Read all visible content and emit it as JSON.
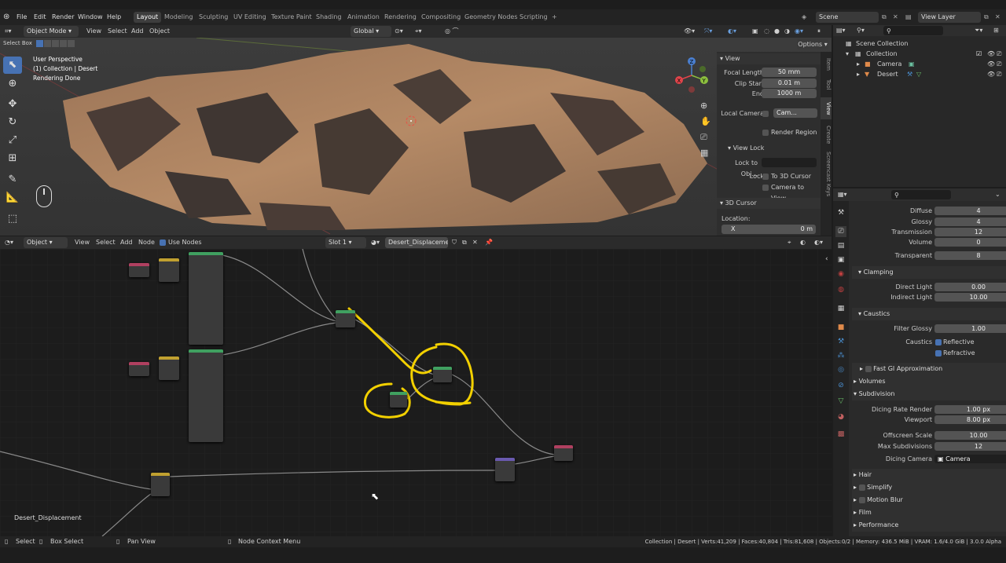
{
  "menu": {
    "items": [
      "File",
      "Edit",
      "Render",
      "Window",
      "Help"
    ]
  },
  "workspaces": [
    "Layout",
    "Modeling",
    "Sculpting",
    "UV Editing",
    "Texture Paint",
    "Shading",
    "Animation",
    "Rendering",
    "Compositing",
    "Geometry Nodes",
    "Scripting"
  ],
  "workspace_add": "+",
  "scene": {
    "label": "Scene",
    "view_layer": "View Layer"
  },
  "viewport": {
    "mode": "Object Mode",
    "menus": [
      "View",
      "Select",
      "Add",
      "Object"
    ],
    "orientation": "Global",
    "select_box": "Select Box",
    "options": "Options",
    "overlay_text": [
      "User Perspective",
      "(1) Collection | Desert",
      "Rendering Done"
    ]
  },
  "npanel": {
    "view_title": "View",
    "focal_length_label": "Focal Length",
    "focal_length": "50 mm",
    "clip_start_label": "Clip Start",
    "clip_start": "0.01 m",
    "end_label": "End",
    "end": "1000 m",
    "local_camera_label": "Local Camera",
    "local_camera_value": "Cam...",
    "render_region": "Render Region",
    "view_lock_title": "View Lock",
    "lock_to_obj_label": "Lock to Obj...",
    "lock_label": "Lock",
    "to_3d_cursor": "To 3D Cursor",
    "camera_to_view": "Camera to View",
    "cursor_title": "3D Cursor",
    "location_label": "Location:",
    "x_label": "X",
    "x_value": "0 m",
    "tabs": [
      "Item",
      "Tool",
      "View",
      "Create",
      "Screencast Keys"
    ]
  },
  "outliner": {
    "scene_collection": "Scene Collection",
    "collection": "Collection",
    "camera": "Camera",
    "desert": "Desert"
  },
  "props": {
    "diffuse_label": "Diffuse",
    "diffuse": "4",
    "glossy_label": "Glossy",
    "glossy": "4",
    "transmission_label": "Transmission",
    "transmission": "12",
    "volume_label": "Volume",
    "volume": "0",
    "transparent_label": "Transparent",
    "transparent": "8",
    "clamping": "Clamping",
    "direct_light_label": "Direct Light",
    "direct_light": "0.00",
    "indirect_light_label": "Indirect Light",
    "indirect_light": "10.00",
    "caustics": "Caustics",
    "filter_glossy_label": "Filter Glossy",
    "filter_glossy": "1.00",
    "caustics_label": "Caustics",
    "reflective": "Reflective",
    "refractive": "Refractive",
    "fast_gi": "Fast GI Approximation",
    "volumes": "Volumes",
    "subdivision": "Subdivision",
    "dicing_rate_label": "Dicing Rate Render",
    "dicing_rate": "1.00 px",
    "viewport_label": "Viewport",
    "viewport_val": "8.00 px",
    "offscreen_label": "Offscreen Scale",
    "offscreen": "10.00",
    "max_subdiv_label": "Max Subdivisions",
    "max_subdiv": "12",
    "dicing_camera_label": "Dicing Camera",
    "dicing_camera": "Camera",
    "hair": "Hair",
    "simplify": "Simplify",
    "motion_blur": "Motion Blur",
    "film": "Film",
    "performance": "Performance"
  },
  "node_editor": {
    "type": "Object",
    "menus": [
      "View",
      "Select",
      "Add",
      "Node"
    ],
    "use_nodes": "Use Nodes",
    "slot": "Slot 1",
    "material": "Desert_Displacement",
    "footer_name": "Desert_Displacement"
  },
  "status": {
    "select": "Select",
    "box_select": "Box Select",
    "pan_view": "Pan View",
    "context_menu": "Node Context Menu",
    "stats": "Collection | Desert | Verts:41,209 | Faces:40,804 | Tris:81,608 | Objects:0/2 | Memory: 436.5 MiB | VRAM: 1.6/4.0 GiB | 3.0.0 Alpha"
  },
  "colors": {
    "accent": "#4772b3",
    "annotation": "#f2d000",
    "active_ws": "#3d3d3d"
  },
  "icons": [
    "blender-logo-icon",
    "cursor-icon",
    "move-icon",
    "rotate-icon",
    "scale-icon",
    "transform-icon",
    "annotate-icon",
    "measure-icon",
    "add-cube-icon",
    "mouse-icon",
    "zoom-icon",
    "hand-icon",
    "camera-icon",
    "grid-icon",
    "eye-icon",
    "camera-render-icon",
    "search-icon",
    "filter-icon"
  ]
}
